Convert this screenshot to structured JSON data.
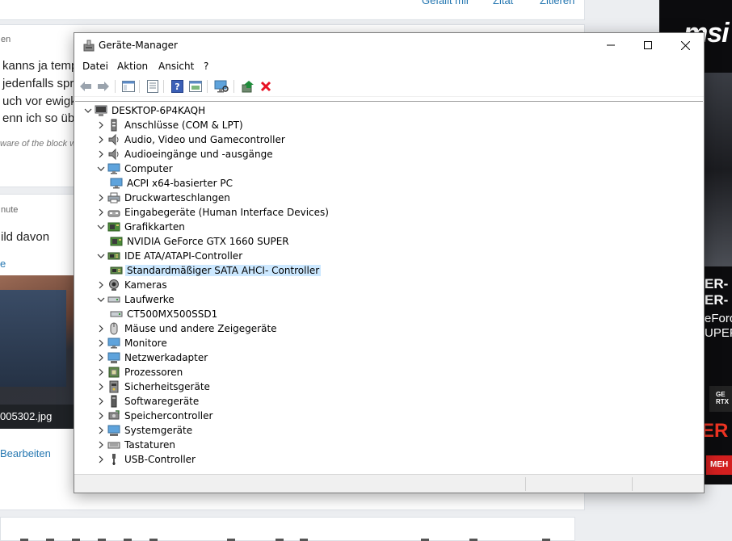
{
  "background": {
    "top_actions": [
      "Gefällt mir",
      "Zitat",
      "Zitieren"
    ],
    "post1_snippet": "en",
    "post1_lines": [
      "kanns ja temp",
      "jedenfalls spr",
      "uch vor ewigk",
      "enn ich so übe"
    ],
    "post1_signature": "ware of the block w",
    "post2_snippet": "nute",
    "post2_text": "ild davon",
    "post2_link": "e",
    "attachment_name": "005302.jpg",
    "edit_link": "Bearbeiten",
    "ad": {
      "logo": "msi",
      "line1": "ER- S",
      "line2": "ER- I",
      "line3": "eForc",
      "line4": "UPEF",
      "nvidia": "GE RTX",
      "red_text": "ER",
      "button": "MEH"
    }
  },
  "window": {
    "title": "Geräte-Manager",
    "menu": [
      "Datei",
      "Aktion",
      "Ansicht",
      "?"
    ],
    "colors": {
      "selection": "#cce8ff",
      "error_red": "#e81123",
      "accent_green": "#1e8c3a"
    }
  },
  "tree": {
    "root": "DESKTOP-6P4KAQH",
    "nodes": [
      {
        "label": "Anschlüsse (COM & LPT)",
        "icon": "port-icon",
        "expanded": false
      },
      {
        "label": "Audio, Video und Gamecontroller",
        "icon": "speaker-icon",
        "expanded": false
      },
      {
        "label": "Audioeingänge und -ausgänge",
        "icon": "speaker-icon",
        "expanded": false
      },
      {
        "label": "Computer",
        "icon": "monitor-icon",
        "expanded": true
      },
      {
        "label": "ACPI x64-basierter PC",
        "icon": "monitor-icon",
        "child": true
      },
      {
        "label": "Druckwarteschlangen",
        "icon": "printer-icon",
        "expanded": false
      },
      {
        "label": "Eingabegeräte (Human Interface Devices)",
        "icon": "hid-icon",
        "expanded": false
      },
      {
        "label": "Grafikkarten",
        "icon": "gpu-icon",
        "expanded": true
      },
      {
        "label": "NVIDIA GeForce GTX 1660 SUPER",
        "icon": "gpu-icon",
        "child": true
      },
      {
        "label": "IDE ATA/ATAPI-Controller",
        "icon": "ide-icon",
        "expanded": true
      },
      {
        "label": "Standardmäßiger SATA AHCI- Controller",
        "icon": "ide-icon",
        "child": true,
        "selected": true
      },
      {
        "label": "Kameras",
        "icon": "camera-icon",
        "expanded": false
      },
      {
        "label": "Laufwerke",
        "icon": "drive-icon",
        "expanded": true
      },
      {
        "label": "CT500MX500SSD1",
        "icon": "drive-icon",
        "child": true
      },
      {
        "label": "Mäuse und andere Zeigegeräte",
        "icon": "mouse-icon",
        "expanded": false
      },
      {
        "label": "Monitore",
        "icon": "monitor-icon",
        "expanded": false
      },
      {
        "label": "Netzwerkadapter",
        "icon": "network-icon",
        "expanded": false
      },
      {
        "label": "Prozessoren",
        "icon": "cpu-icon",
        "expanded": false
      },
      {
        "label": "Sicherheitsgeräte",
        "icon": "security-icon",
        "expanded": false
      },
      {
        "label": "Softwaregeräte",
        "icon": "software-icon",
        "expanded": false
      },
      {
        "label": "Speichercontroller",
        "icon": "storage-icon",
        "expanded": false
      },
      {
        "label": "Systemgeräte",
        "icon": "system-icon",
        "expanded": false
      },
      {
        "label": "Tastaturen",
        "icon": "keyboard-icon",
        "expanded": false
      },
      {
        "label": "USB-Controller",
        "icon": "usb-icon",
        "expanded": false
      }
    ]
  }
}
